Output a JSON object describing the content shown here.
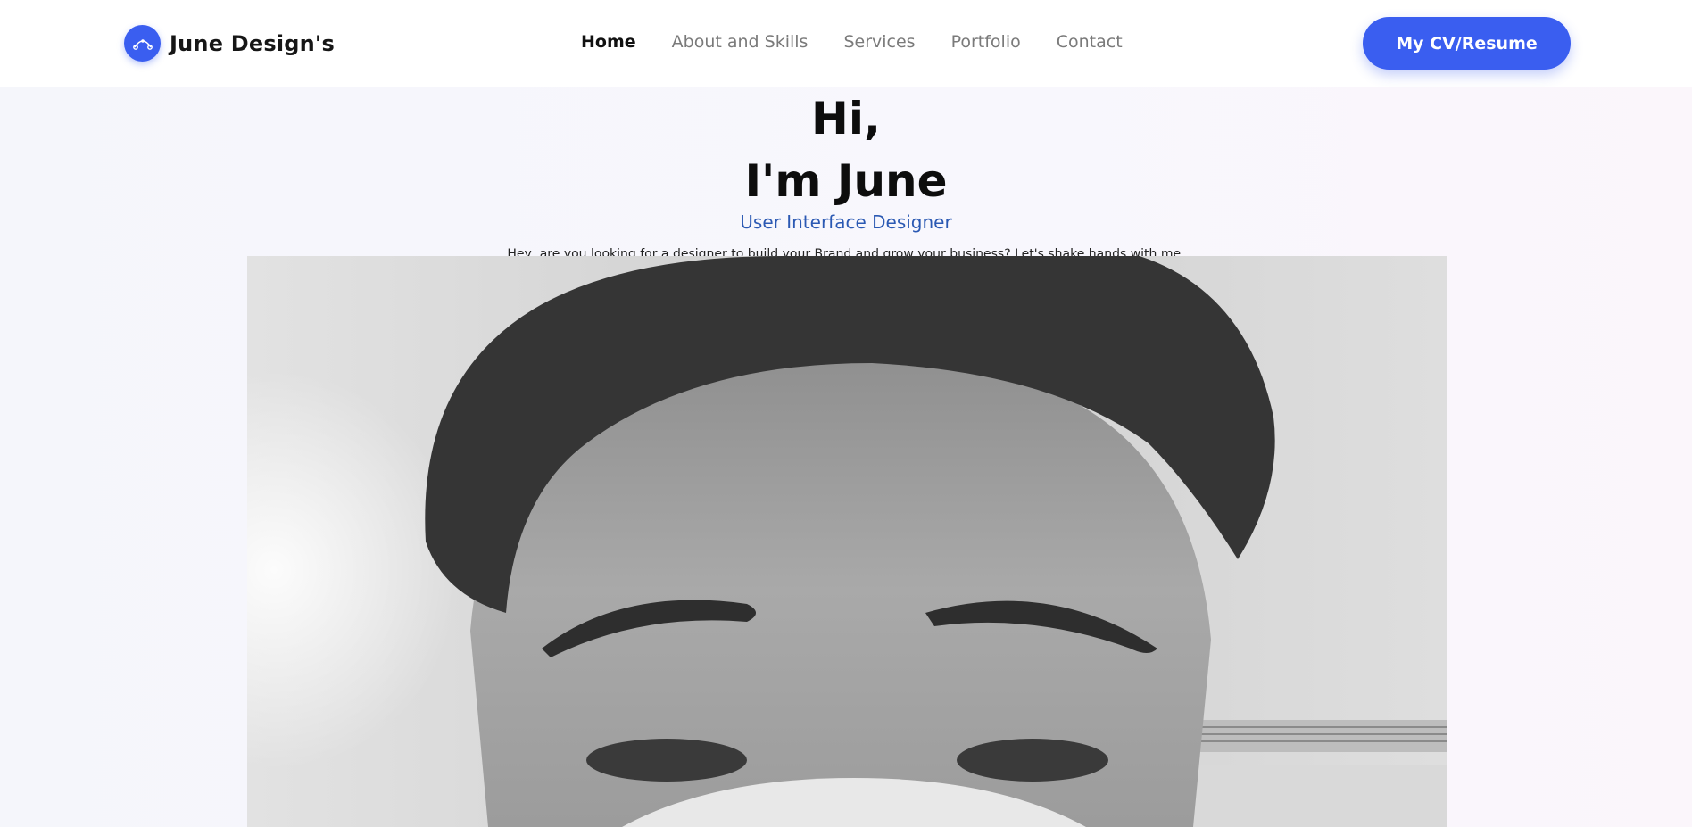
{
  "header": {
    "brand": "June Design's",
    "logo_icon": "vector-pen-icon",
    "nav": [
      {
        "label": "Home",
        "active": true
      },
      {
        "label": "About and Skills",
        "active": false
      },
      {
        "label": "Services",
        "active": false
      },
      {
        "label": "Portfolio",
        "active": false
      },
      {
        "label": "Contact",
        "active": false
      }
    ],
    "cv_button": "My CV/Resume"
  },
  "hero": {
    "greeting": "Hi,",
    "name_line": "I'm June",
    "role": "User Interface Designer",
    "description": "Hey, are you looking for a designer to build your Brand and grow your business? Let's shake hands with me.",
    "photo_style": "grayscale portrait"
  },
  "colors": {
    "accent": "#3a5ef0",
    "role_text": "#2b59b3",
    "background": "#f7f7fc"
  }
}
